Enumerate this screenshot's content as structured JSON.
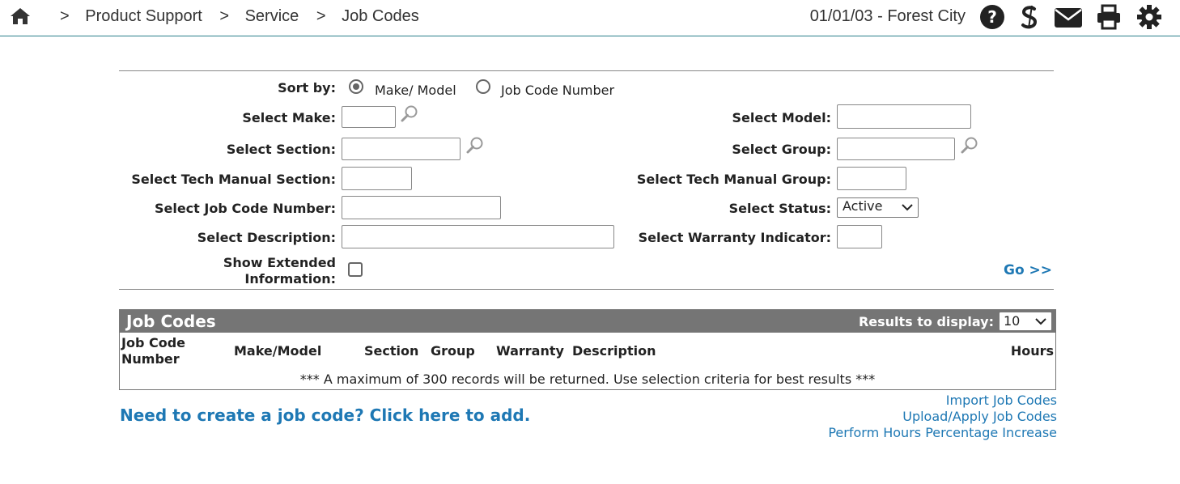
{
  "breadcrumb": {
    "separator": ">",
    "items": [
      "Product Support",
      "Service",
      "Job Codes"
    ]
  },
  "header": {
    "dealer": "01/01/03 - Forest City",
    "icons": [
      "home-icon",
      "help-icon",
      "s-icon",
      "mail-icon",
      "print-icon",
      "gear-icon"
    ]
  },
  "form": {
    "sort_by_label": "Sort by:",
    "sort_options": [
      "Make/ Model",
      "Job Code Number"
    ],
    "sort_selected": "Make/ Model",
    "select_make_label": "Select Make:",
    "select_model_label": "Select Model:",
    "select_section_label": "Select Section:",
    "select_group_label": "Select Group:",
    "tech_manual_section_label": "Select Tech Manual Section:",
    "tech_manual_group_label": "Select Tech Manual Group:",
    "job_code_number_label": "Select Job Code Number:",
    "status_label": "Select Status:",
    "status_value": "Active",
    "description_label": "Select Description:",
    "warranty_indicator_label": "Select Warranty Indicator:",
    "extended_info_label_line1": "Show Extended",
    "extended_info_label_line2": "Information:",
    "go_label": "Go >>"
  },
  "results": {
    "title": "Job Codes",
    "results_to_display_label": "Results to display:",
    "results_to_display_value": "10",
    "columns": {
      "job_code_number_line1": "Job Code",
      "job_code_number_line2": "Number",
      "make_model": "Make/Model",
      "section": "Section",
      "group": "Group",
      "warranty": "Warranty",
      "description": "Description",
      "hours": "Hours"
    },
    "note": "*** A maximum of 300 records will be returned. Use selection criteria for best results ***"
  },
  "links": {
    "add_job_code": "Need to create a job code? Click here to add.",
    "import": "Import Job Codes",
    "upload_apply": "Upload/Apply Job Codes",
    "hours_increase": "Perform Hours Percentage Increase"
  },
  "colors": {
    "link": "#1e78b4",
    "header_bar": "#757575",
    "top_rule": "#2a7f8a"
  }
}
